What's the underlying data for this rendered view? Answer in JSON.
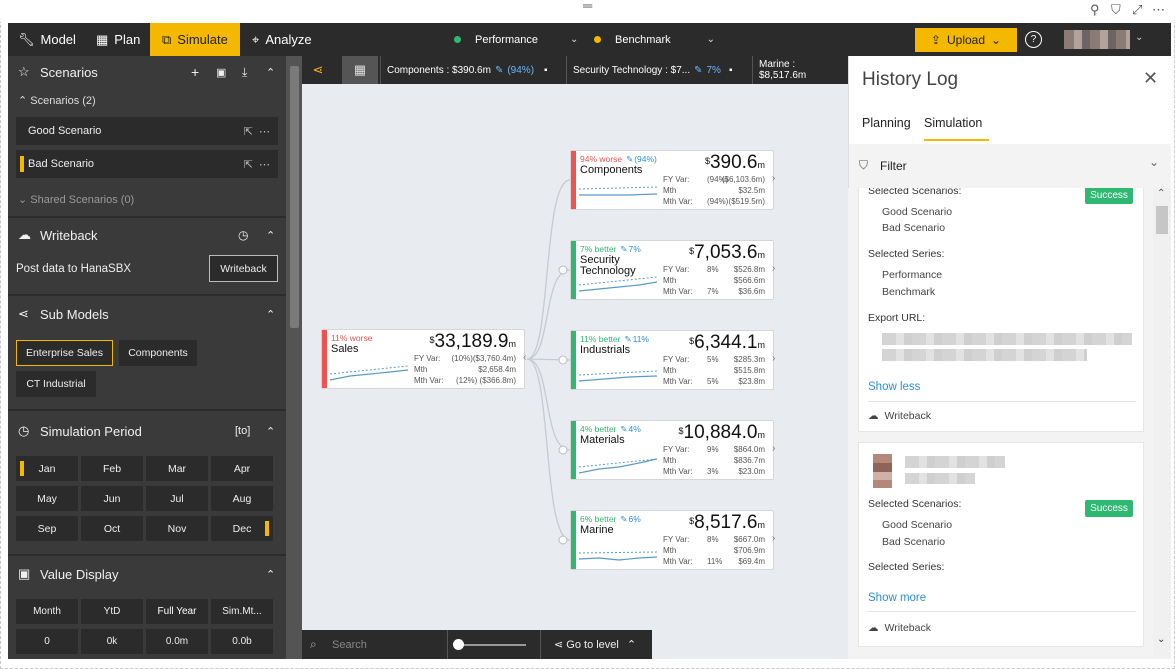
{
  "topnav": {
    "tabs": [
      {
        "label": "Model",
        "icon": "wrench-icon"
      },
      {
        "label": "Plan",
        "icon": "table-icon"
      },
      {
        "label": "Simulate",
        "icon": "flow-icon"
      },
      {
        "label": "Analyze",
        "icon": "telescope-icon"
      }
    ],
    "series": [
      {
        "label": "Performance",
        "color": "#2fb872"
      },
      {
        "label": "Benchmark",
        "color": "#f5b800"
      }
    ],
    "upload_label": "Upload",
    "help_label": "?"
  },
  "left": {
    "scenarios": {
      "title": "Scenarios",
      "group_label": "Scenarios (2)",
      "items": [
        "Good Scenario",
        "Bad Scenario"
      ],
      "shared_label": "Shared Scenarios (0)"
    },
    "writeback": {
      "title": "Writeback",
      "post_label": "Post data to HanaSBX",
      "button_label": "Writeback"
    },
    "submodels": {
      "title": "Sub Models",
      "chips": [
        "Enterprise Sales",
        "Components",
        "CT Industrial"
      ]
    },
    "period": {
      "title": "Simulation Period",
      "badge": "[to]",
      "months": [
        "Jan",
        "Feb",
        "Mar",
        "Apr",
        "May",
        "Jun",
        "Jul",
        "Aug",
        "Sep",
        "Oct",
        "Nov",
        "Dec"
      ]
    },
    "value_display": {
      "title": "Value Display",
      "headers": [
        "Month",
        "YtD",
        "Full Year",
        "Sim.Mt..."
      ],
      "values": [
        "0",
        "0k",
        "0.0m",
        "0.0b"
      ]
    }
  },
  "crumbs": [
    {
      "label": "Components : $390.6m",
      "pct": "(94%)"
    },
    {
      "label": "Security Technology : $7...",
      "pct": "7%"
    },
    {
      "label": "Marine : $8,517.6m",
      "pct": ""
    }
  ],
  "root": {
    "var": "11% worse",
    "name": "Sales",
    "value": "33,189.9",
    "unit": "m",
    "fy": "(10%)($3,760.4m)",
    "mth": "$2,658.4m",
    "mthvar": "(12%)  ($366.8m)"
  },
  "nodes": [
    {
      "var": "94% worse",
      "pen": "(94%)",
      "name": "Components",
      "value": "390.6",
      "unit": "m",
      "fy1": "(94%)",
      "fy2": "($6,103.6m)",
      "mth": "$32.5m",
      "mv1": "(94%)",
      "mv2": "($519.5m)",
      "color": "#ef5350"
    },
    {
      "var": "7% better",
      "pen": "7%",
      "name": "Security Technology",
      "value": "7,053.6",
      "unit": "m",
      "fy1": "8%",
      "fy2": "$526.8m",
      "mth": "$566.6m",
      "mv1": "7%",
      "mv2": "$36.6m",
      "color": "#2fb872"
    },
    {
      "var": "11% better",
      "pen": "11%",
      "name": "Industrials",
      "value": "6,344.1",
      "unit": "m",
      "fy1": "5%",
      "fy2": "$285.3m",
      "mth": "$515.8m",
      "mv1": "5%",
      "mv2": "$23.8m",
      "color": "#2fb872"
    },
    {
      "var": "4% better",
      "pen": "4%",
      "name": "Materials",
      "value": "10,884.0",
      "unit": "m",
      "fy1": "9%",
      "fy2": "$864.0m",
      "mth": "$836.7m",
      "mv1": "3%",
      "mv2": "$23.0m",
      "color": "#2fb872"
    },
    {
      "var": "6% better",
      "pen": "6%",
      "name": "Marine",
      "value": "8,517.6",
      "unit": "m",
      "fy1": "8%",
      "fy2": "$667.0m",
      "mth": "$706.9m",
      "mv1": "11%",
      "mv2": "$69.4m",
      "color": "#2fb872"
    }
  ],
  "kv_labels": {
    "fy": "FY Var:",
    "mth": "Mth",
    "mthvar": "Mth Var:"
  },
  "search": {
    "placeholder": "Search",
    "goto": "Go to level"
  },
  "history": {
    "title": "History Log",
    "tabs": [
      "Planning",
      "Simulation"
    ],
    "filter_label": "Filter",
    "entries": [
      {
        "status": "Success",
        "scen_label": "Selected Scenarios:",
        "scenarios": [
          "Good Scenario",
          "Bad Scenario"
        ],
        "series_label": "Selected Series:",
        "series": [
          "Performance",
          "Benchmark"
        ],
        "export_label": "Export URL:",
        "toggle": "Show less",
        "action": "Writeback"
      },
      {
        "status": "Success",
        "scen_label": "Selected Scenarios:",
        "scenarios": [
          "Good Scenario",
          "Bad Scenario"
        ],
        "series_label": "Selected Series:",
        "toggle": "Show more",
        "action": "Writeback"
      }
    ]
  }
}
